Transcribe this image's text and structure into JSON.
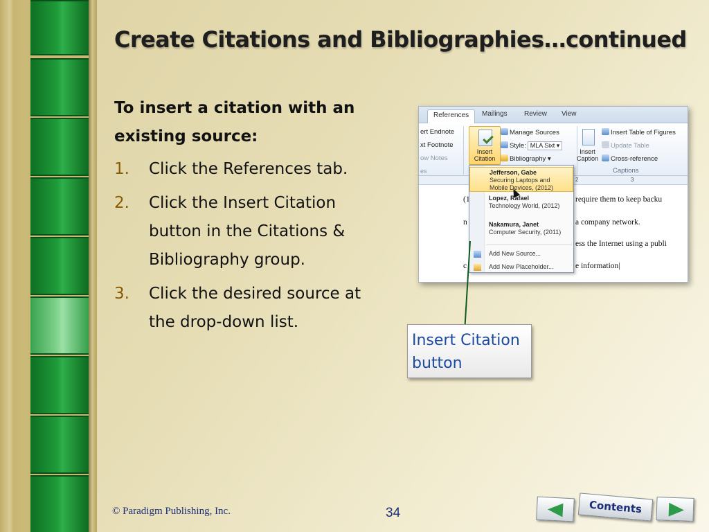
{
  "slide": {
    "title": "Create Citations and Bibliographies…continued",
    "intro": "To insert a citation with an existing source:",
    "steps": [
      {
        "num": "1.",
        "text": "Click the References tab."
      },
      {
        "num": "2.",
        "text": "Click the Insert Citation button in the Citations & Bibliography group."
      },
      {
        "num": "3.",
        "text": "Click the desired source at the drop-down list."
      }
    ]
  },
  "screenshot": {
    "tabs": [
      "References",
      "Mailings",
      "Review",
      "View"
    ],
    "ribbon": {
      "insert_endnote": "ert Endnote",
      "next_footnote": "xt Footnote",
      "show_notes": "ow Notes",
      "footnotes_group_tail": "es",
      "insert_citation_line1": "Insert",
      "insert_citation_line2": "Citation",
      "manage_sources": "Manage Sources",
      "style_label": "Style:",
      "style_value": "MLA Sixt",
      "bibliography": "Bibliography",
      "insert_caption_line1": "Insert",
      "insert_caption_line2": "Caption",
      "insert_table_of_figures": "Insert Table of Figures",
      "update_table": "Update Table",
      "cross_reference": "Cross-reference",
      "captions_group": "Captions"
    },
    "ruler_mark_2": "2",
    "ruler_mark_3": "3",
    "document_lines": [
      "(1",
      "require them to keep backu",
      "n",
      "a company network.",
      "ess the Internet using a publi",
      "c",
      "e information"
    ],
    "dropdown": [
      {
        "name": "Jefferson, Gabe",
        "detail1": "Securing Laptops and",
        "detail2": "Mobile Devices, (2012)"
      },
      {
        "name": "Lopez, Rafael",
        "detail1": "Technology World, (2012)",
        "detail2": ""
      },
      {
        "name": "Nakamura, Janet",
        "detail1": "Computer Security, (2011)",
        "detail2": ""
      }
    ],
    "add_new_source": "Add New Source...",
    "add_new_placeholder": "Add New Placeholder..."
  },
  "callout": {
    "line1": "Insert Citation",
    "line2": "button"
  },
  "footer": {
    "copyright": "© Paradigm Publishing, Inc.",
    "page_number": "34",
    "contents_label": "Contents"
  },
  "colors": {
    "accent_green": "#2e9b4a",
    "title_text": "#1e1e1e",
    "footer_text": "#1c2e7a",
    "callout_text": "#1c4aa0"
  }
}
